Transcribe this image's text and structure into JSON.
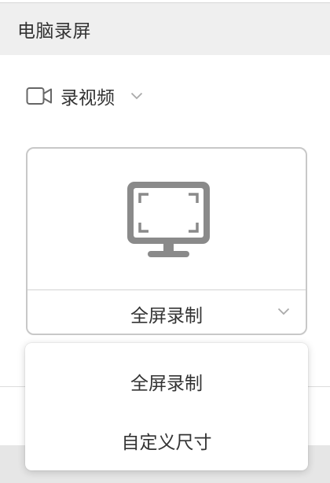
{
  "window": {
    "title": "电脑录屏"
  },
  "mode_selector": {
    "icon": "video-camera-icon",
    "label": "录视频",
    "dropdown_icon": "chevron-down-icon"
  },
  "record_area": {
    "icon": "monitor-fullscreen-icon",
    "selected_mode": "全屏录制",
    "dropdown_icon": "chevron-down-icon"
  },
  "dropdown_menu": {
    "items": [
      {
        "label": "全屏录制"
      },
      {
        "label": "自定义尺寸"
      }
    ]
  },
  "colors": {
    "title_bar_bg": "#efefef",
    "icon_gray": "#8a8a8a",
    "card_border": "#c8c8c8",
    "text": "#333333"
  }
}
